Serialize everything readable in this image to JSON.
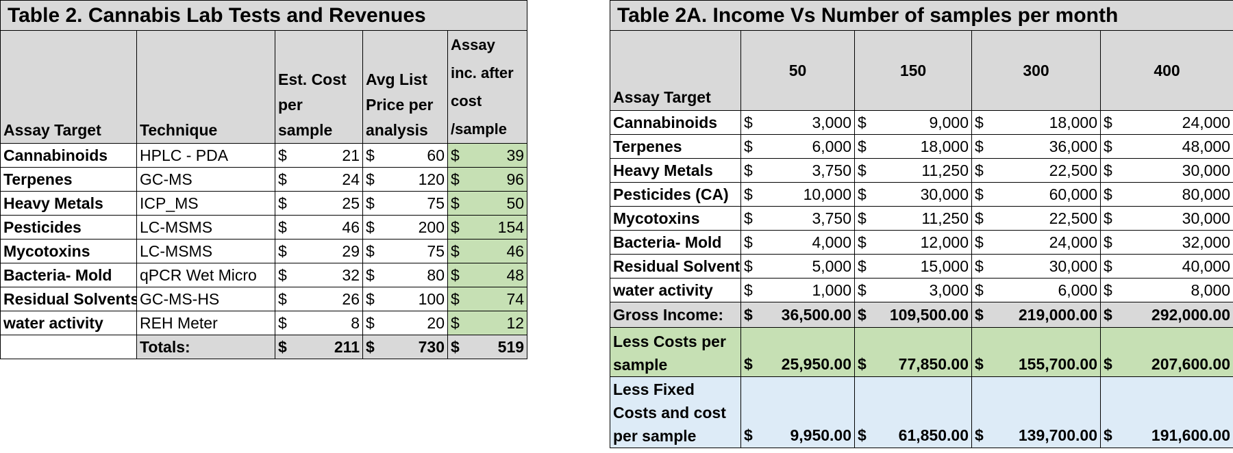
{
  "table2": {
    "title": "Table 2.   Cannabis Lab Tests and Revenues",
    "headers": [
      "Assay Target",
      "Technique",
      "Est. Cost per sample",
      "Avg List Price per analysis",
      "Assay inc. after cost /sample"
    ],
    "rows": [
      {
        "assay": "Cannabinoids",
        "technique": "HPLC - PDA",
        "cost": "21",
        "price": "60",
        "inc": "39"
      },
      {
        "assay": "Terpenes",
        "technique": "GC-MS",
        "cost": "24",
        "price": "120",
        "inc": "96"
      },
      {
        "assay": "Heavy Metals",
        "technique": "ICP_MS",
        "cost": "25",
        "price": "75",
        "inc": "50"
      },
      {
        "assay": "Pesticides",
        "technique": "LC-MSMS",
        "cost": "46",
        "price": "200",
        "inc": "154"
      },
      {
        "assay": "Mycotoxins",
        "technique": "LC-MSMS",
        "cost": "29",
        "price": "75",
        "inc": "46"
      },
      {
        "assay": "Bacteria- Mold",
        "technique": "qPCR  Wet Micro",
        "cost": "32",
        "price": "80",
        "inc": "48"
      },
      {
        "assay": "Residual Solvents",
        "technique": "GC-MS-HS",
        "cost": "26",
        "price": "100",
        "inc": "74"
      },
      {
        "assay": "water activity",
        "technique": "REH Meter",
        "cost": "8",
        "price": "20",
        "inc": "12"
      }
    ],
    "totals": {
      "label": "Totals:",
      "cost": "211",
      "price": "730",
      "inc": "519"
    },
    "currency": "$"
  },
  "table2a": {
    "title": "Table 2A.    Income Vs Number of samples per month",
    "header_label": "Assay Target",
    "columns": [
      "50",
      "150",
      "300",
      "400"
    ],
    "rows": [
      {
        "assay": "Cannabinoids",
        "values": [
          "3,000",
          "9,000",
          "18,000",
          "24,000"
        ]
      },
      {
        "assay": "Terpenes",
        "values": [
          "6,000",
          "18,000",
          "36,000",
          "48,000"
        ]
      },
      {
        "assay": "Heavy Metals",
        "values": [
          "3,750",
          "11,250",
          "22,500",
          "30,000"
        ]
      },
      {
        "assay": "Pesticides (CA)",
        "values": [
          "10,000",
          "30,000",
          "60,000",
          "80,000"
        ]
      },
      {
        "assay": "Mycotoxins",
        "values": [
          "3,750",
          "11,250",
          "22,500",
          "30,000"
        ]
      },
      {
        "assay": "Bacteria- Mold",
        "values": [
          "4,000",
          "12,000",
          "24,000",
          "32,000"
        ]
      },
      {
        "assay": "Residual Solvents",
        "values": [
          "5,000",
          "15,000",
          "30,000",
          "40,000"
        ]
      },
      {
        "assay": "water activity",
        "values": [
          "1,000",
          "3,000",
          "6,000",
          "8,000"
        ]
      }
    ],
    "gross": {
      "label": "Gross Income:",
      "values": [
        "36,500.00",
        "109,500.00",
        "219,000.00",
        "292,000.00"
      ]
    },
    "less_costs": {
      "label": "Less Costs per sample",
      "values": [
        "25,950.00",
        "77,850.00",
        "155,700.00",
        "207,600.00"
      ]
    },
    "less_fixed": {
      "label": "Less Fixed Costs and cost per sample",
      "values": [
        "9,950.00",
        "61,850.00",
        "139,700.00",
        "191,600.00"
      ]
    },
    "currency": "$"
  },
  "colors": {
    "gray": "#d9d9d9",
    "green": "#c6e0b4",
    "blue": "#ddebf7"
  }
}
